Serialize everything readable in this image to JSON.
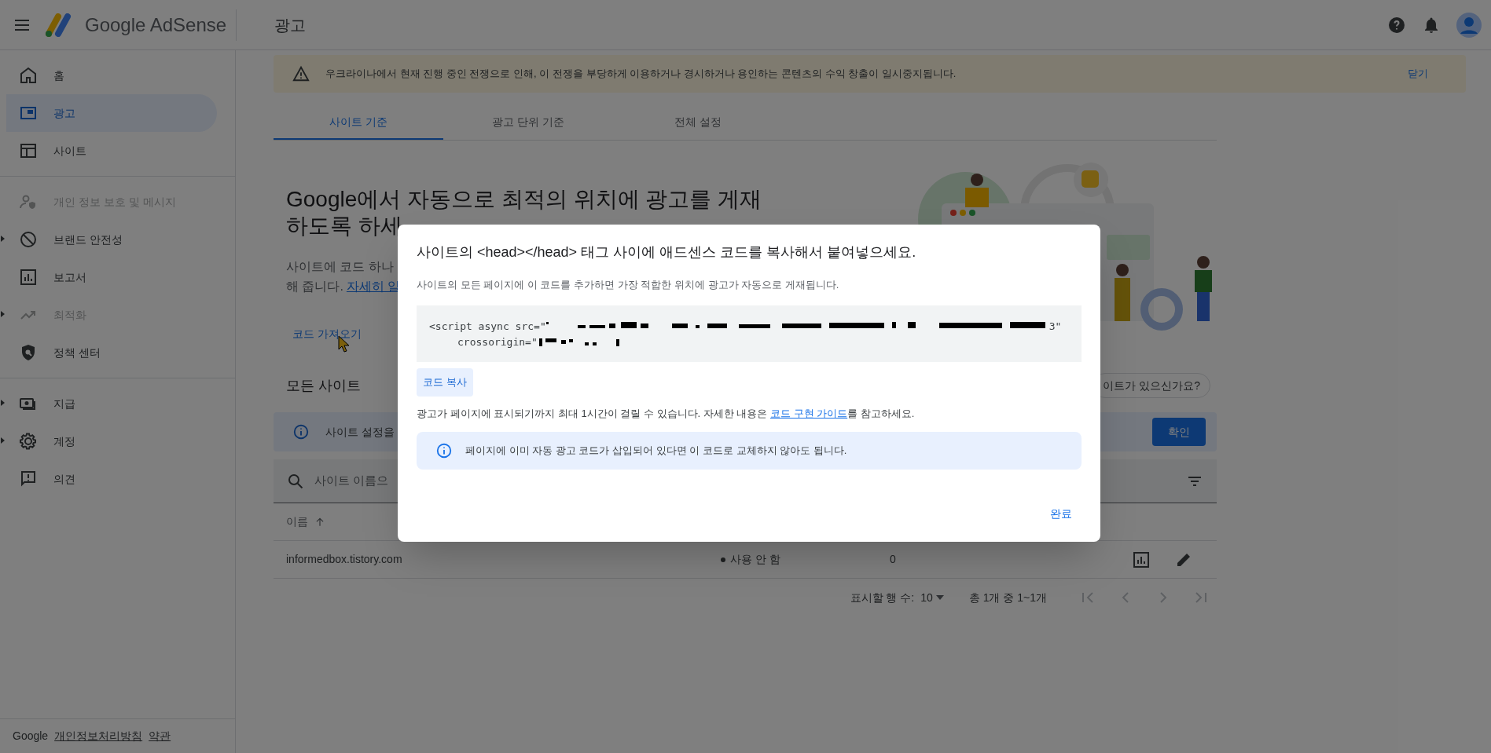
{
  "topbar": {
    "product": "Google AdSense",
    "page_title": "광고"
  },
  "sidebar": {
    "items": [
      {
        "label": "홈",
        "selected": false,
        "disabled": false,
        "expandable": false
      },
      {
        "label": "광고",
        "selected": true,
        "disabled": false,
        "expandable": false
      },
      {
        "label": "사이트",
        "selected": false,
        "disabled": false,
        "expandable": false
      },
      {
        "label": "개인 정보 보호 및 메시지",
        "selected": false,
        "disabled": true,
        "expandable": false
      },
      {
        "label": "브랜드 안전성",
        "selected": false,
        "disabled": false,
        "expandable": true
      },
      {
        "label": "보고서",
        "selected": false,
        "disabled": false,
        "expandable": false
      },
      {
        "label": "최적화",
        "selected": false,
        "disabled": true,
        "expandable": true
      },
      {
        "label": "정책 센터",
        "selected": false,
        "disabled": false,
        "expandable": false
      },
      {
        "label": "지급",
        "selected": false,
        "disabled": false,
        "expandable": true
      },
      {
        "label": "계정",
        "selected": false,
        "disabled": false,
        "expandable": true
      },
      {
        "label": "의견",
        "selected": false,
        "disabled": false,
        "expandable": false
      }
    ],
    "footer": {
      "brand": "Google",
      "links": [
        "개인정보처리방침",
        "약관"
      ]
    }
  },
  "banner": {
    "text": "우크라이나에서 현재 진행 중인 전쟁으로 인해, 이 전쟁을 부당하게 이용하거나 경시하거나 용인하는 콘텐츠의 수익 창출이 일시중지됩니다.",
    "dismiss": "닫기"
  },
  "tabs": [
    {
      "label": "사이트 기준",
      "selected": true
    },
    {
      "label": "광고 단위 기준",
      "selected": false
    },
    {
      "label": "전체 설정",
      "selected": false
    }
  ],
  "hero": {
    "heading_lines": [
      "Google에서 자동으로 최적의 위치에 광고를 게재",
      "하도록 하세"
    ],
    "description_line_1": "사이트에 코드 하나",
    "description_line_2": "해 줍니다.",
    "learn_more": "자세히 알",
    "get_code": "코드 가져오기"
  },
  "sites": {
    "title": "모든 사이트",
    "add_chip": "이트가 있으신가요?",
    "info_text": "사이트 설정을",
    "confirm": "확인",
    "search_placeholder": "사이트 이름으",
    "columns": [
      {
        "label": "이름",
        "sorted": true
      }
    ],
    "rows": [
      {
        "name": "informedbox.tistory.com",
        "status": "사용 안 함",
        "value": "0"
      }
    ],
    "pagination": {
      "rows_label": "표시할 행 수:",
      "rows_value": "10",
      "range": "총 1개 중 1~1개"
    }
  },
  "dialog": {
    "title": "사이트의 <head></head> 태그 사이에 애드센스 코드를 복사해서 붙여넣으세요.",
    "description": "사이트의 모든 페이지에 이 코드를 추가하면 가장 적합한 위치에 광고가 자동으로 게재됩니다.",
    "code_line_1": "<script async src=\"",
    "code_line_1_end": "3\"",
    "code_line_2": "crossorigin=\"",
    "copy_button": "코드 복사",
    "note_before": "광고가 페이지에 표시되기까지 최대 1시간이 걸릴 수 있습니다. 자세한 내용은 ",
    "note_link": "코드 구현 가이드",
    "note_after": "를 참고하세요.",
    "info": "페이지에 이미 자동 광고 코드가 삽입되어 있다면 이 코드로 교체하지 않아도 됩니다.",
    "done": "완료"
  }
}
